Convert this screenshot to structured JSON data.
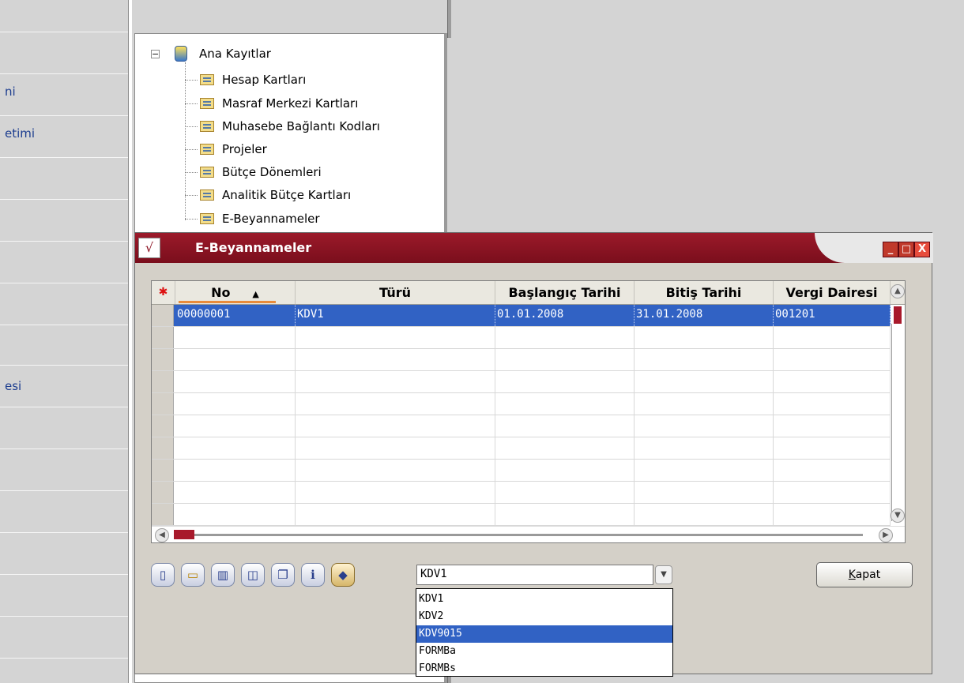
{
  "sidebar": {
    "items": [
      {
        "label": "ni"
      },
      {
        "label": "etimi"
      },
      {
        "label": "esi"
      }
    ]
  },
  "tree": {
    "root": "Ana Kayıtlar",
    "children": [
      "Hesap Kartları",
      "Masraf Merkezi Kartları",
      "Muhasebe Bağlantı Kodları",
      "Projeler",
      "Bütçe Dönemleri",
      "Analitik Bütçe Kartları",
      "E-Beyannameler"
    ]
  },
  "dialog": {
    "title": "E-Beyannameler",
    "buttons": {
      "minimize": "_",
      "maximize": "□",
      "close": "X"
    },
    "grid": {
      "columns": [
        "No",
        "Türü",
        "Başlangıç Tarihi",
        "Bitiş Tarihi",
        "Vergi Dairesi"
      ],
      "rows": [
        [
          "00000001",
          "KDV1",
          "01.01.2008",
          "31.01.2008",
          "001201"
        ]
      ]
    },
    "combo": {
      "value": "KDV1",
      "options": [
        "KDV1",
        "KDV2",
        "KDV9015",
        "FORMBa",
        "FORMBs"
      ],
      "highlighted": "KDV9015"
    },
    "close_button": {
      "prefix": "K",
      "rest": "apat"
    }
  },
  "colors": {
    "titlebar": "#8b1424",
    "selection": "#3162c4",
    "sort_indicator": "#e98b3a"
  },
  "icons": [
    "new-document-icon",
    "open-folder-icon",
    "trash-icon",
    "preview-icon",
    "copy-icon",
    "info-icon",
    "filter-icon"
  ]
}
